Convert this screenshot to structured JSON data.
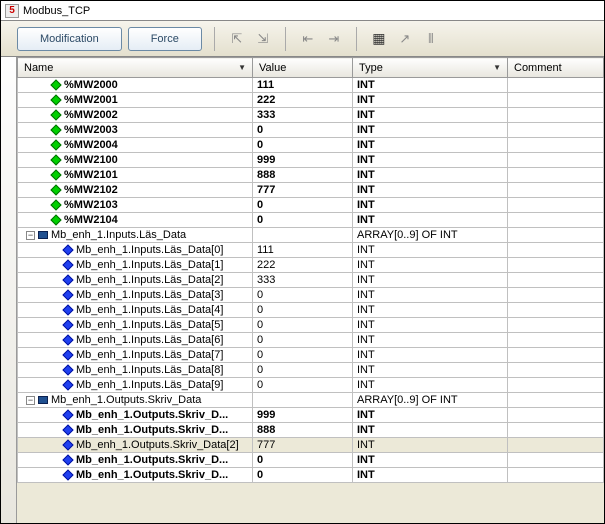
{
  "window": {
    "title": "Modbus_TCP"
  },
  "toolbar": {
    "modification_label": "Modification",
    "force_label": "Force"
  },
  "columns": {
    "name": "Name",
    "value": "Value",
    "type": "Type",
    "comment": "Comment"
  },
  "rows": [
    {
      "indent": 1,
      "icon": "green-diamond",
      "bold": true,
      "name": "%MW2000",
      "value": "111",
      "type": "INT",
      "comment": ""
    },
    {
      "indent": 1,
      "icon": "green-diamond",
      "bold": true,
      "name": "%MW2001",
      "value": "222",
      "type": "INT",
      "comment": ""
    },
    {
      "indent": 1,
      "icon": "green-diamond",
      "bold": true,
      "name": "%MW2002",
      "value": "333",
      "type": "INT",
      "comment": ""
    },
    {
      "indent": 1,
      "icon": "green-diamond",
      "bold": true,
      "name": "%MW2003",
      "value": "0",
      "type": "INT",
      "comment": ""
    },
    {
      "indent": 1,
      "icon": "green-diamond",
      "bold": true,
      "name": "%MW2004",
      "value": "0",
      "type": "INT",
      "comment": ""
    },
    {
      "indent": 1,
      "icon": "green-diamond",
      "bold": true,
      "name": "%MW2100",
      "value": "999",
      "type": "INT",
      "comment": ""
    },
    {
      "indent": 1,
      "icon": "green-diamond",
      "bold": true,
      "name": "%MW2101",
      "value": "888",
      "type": "INT",
      "comment": ""
    },
    {
      "indent": 1,
      "icon": "green-diamond",
      "bold": true,
      "name": "%MW2102",
      "value": "777",
      "type": "INT",
      "comment": ""
    },
    {
      "indent": 1,
      "icon": "green-diamond",
      "bold": true,
      "name": "%MW2103",
      "value": "0",
      "type": "INT",
      "comment": ""
    },
    {
      "indent": 1,
      "icon": "green-diamond",
      "bold": true,
      "name": "%MW2104",
      "value": "0",
      "type": "INT",
      "comment": ""
    },
    {
      "indent": 0,
      "icon": "array",
      "expand": "-",
      "bold": false,
      "name": "Mb_enh_1.Inputs.Läs_Data",
      "value": "",
      "type": "ARRAY[0..9] OF INT",
      "comment": ""
    },
    {
      "indent": 2,
      "icon": "blue-diamond",
      "bold": false,
      "name": "Mb_enh_1.Inputs.Läs_Data[0]",
      "value": "111",
      "type": "INT",
      "comment": ""
    },
    {
      "indent": 2,
      "icon": "blue-diamond",
      "bold": false,
      "name": "Mb_enh_1.Inputs.Läs_Data[1]",
      "value": "222",
      "type": "INT",
      "comment": ""
    },
    {
      "indent": 2,
      "icon": "blue-diamond",
      "bold": false,
      "name": "Mb_enh_1.Inputs.Läs_Data[2]",
      "value": "333",
      "type": "INT",
      "comment": ""
    },
    {
      "indent": 2,
      "icon": "blue-diamond",
      "bold": false,
      "name": "Mb_enh_1.Inputs.Läs_Data[3]",
      "value": "0",
      "type": "INT",
      "comment": ""
    },
    {
      "indent": 2,
      "icon": "blue-diamond",
      "bold": false,
      "name": "Mb_enh_1.Inputs.Läs_Data[4]",
      "value": "0",
      "type": "INT",
      "comment": ""
    },
    {
      "indent": 2,
      "icon": "blue-diamond",
      "bold": false,
      "name": "Mb_enh_1.Inputs.Läs_Data[5]",
      "value": "0",
      "type": "INT",
      "comment": ""
    },
    {
      "indent": 2,
      "icon": "blue-diamond",
      "bold": false,
      "name": "Mb_enh_1.Inputs.Läs_Data[6]",
      "value": "0",
      "type": "INT",
      "comment": ""
    },
    {
      "indent": 2,
      "icon": "blue-diamond",
      "bold": false,
      "name": "Mb_enh_1.Inputs.Läs_Data[7]",
      "value": "0",
      "type": "INT",
      "comment": ""
    },
    {
      "indent": 2,
      "icon": "blue-diamond",
      "bold": false,
      "name": "Mb_enh_1.Inputs.Läs_Data[8]",
      "value": "0",
      "type": "INT",
      "comment": ""
    },
    {
      "indent": 2,
      "icon": "blue-diamond",
      "bold": false,
      "name": "Mb_enh_1.Inputs.Läs_Data[9]",
      "value": "0",
      "type": "INT",
      "comment": ""
    },
    {
      "indent": 0,
      "icon": "array",
      "expand": "-",
      "bold": false,
      "name": "Mb_enh_1.Outputs.Skriv_Data",
      "value": "",
      "type": "ARRAY[0..9] OF INT",
      "comment": ""
    },
    {
      "indent": 2,
      "icon": "blue-diamond",
      "bold": true,
      "name": "Mb_enh_1.Outputs.Skriv_D...",
      "value": "999",
      "type": "INT",
      "comment": ""
    },
    {
      "indent": 2,
      "icon": "blue-diamond",
      "bold": true,
      "name": "Mb_enh_1.Outputs.Skriv_D...",
      "value": "888",
      "type": "INT",
      "comment": ""
    },
    {
      "indent": 2,
      "icon": "blue-diamond",
      "bold": false,
      "name": "Mb_enh_1.Outputs.Skriv_Data[2]",
      "value": "777",
      "type": "INT",
      "comment": "",
      "selected": true
    },
    {
      "indent": 2,
      "icon": "blue-diamond",
      "bold": true,
      "name": "Mb_enh_1.Outputs.Skriv_D...",
      "value": "0",
      "type": "INT",
      "comment": ""
    },
    {
      "indent": 2,
      "icon": "blue-diamond",
      "bold": true,
      "name": "Mb_enh_1.Outputs.Skriv_D...",
      "value": "0",
      "type": "INT",
      "comment": ""
    }
  ]
}
